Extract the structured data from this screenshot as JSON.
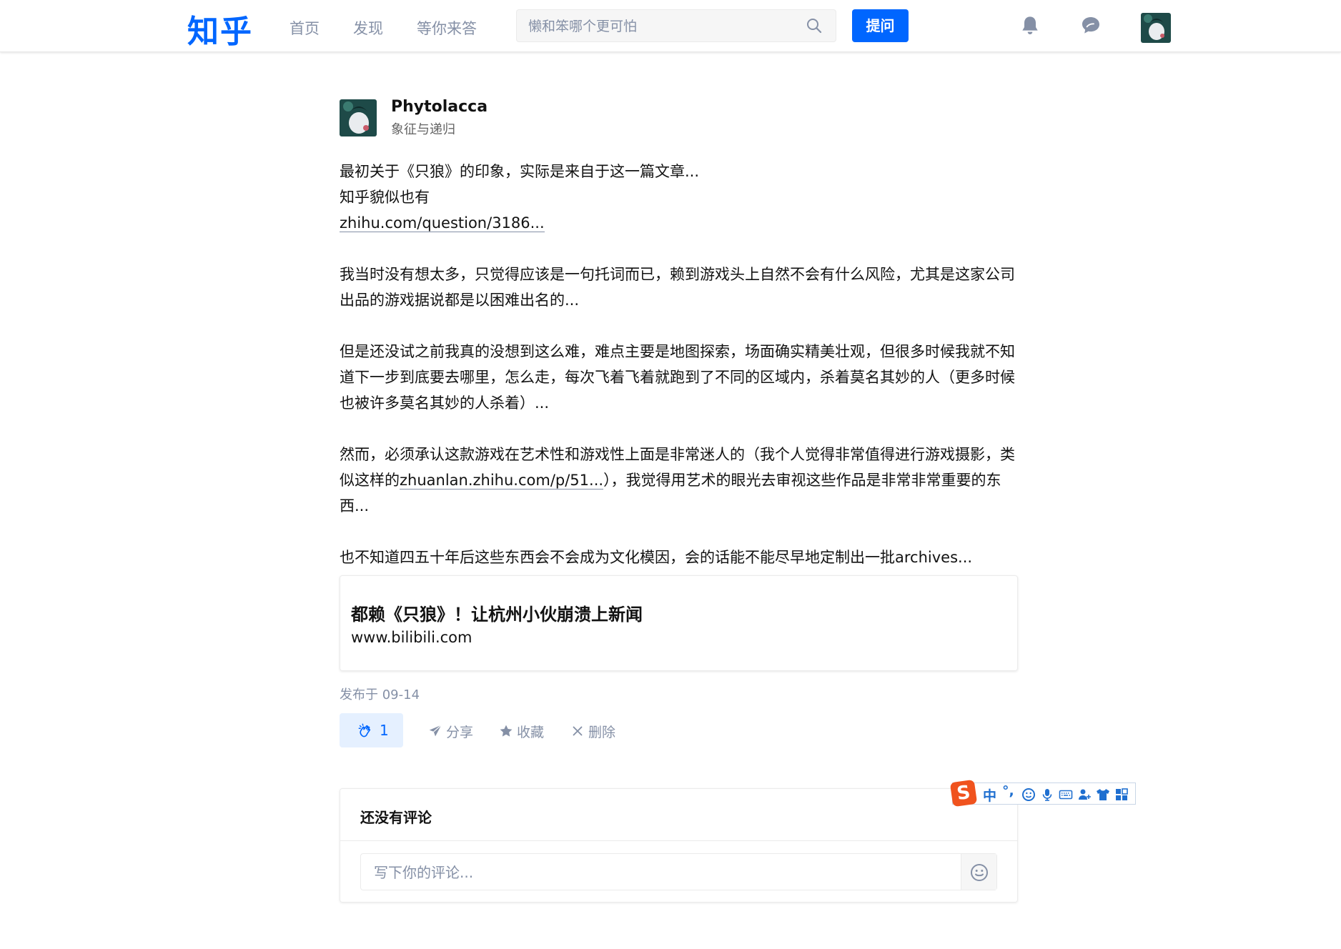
{
  "header": {
    "logo": "知乎",
    "nav": [
      "首页",
      "发现",
      "等你来答"
    ],
    "search_placeholder": "懒和笨哪个更可怕",
    "ask_label": "提问",
    "icons": [
      "bell-icon",
      "chat-icon"
    ],
    "accent_color": "#0066ff"
  },
  "post": {
    "author_name": "Phytolacca",
    "author_bio": "象征与递归",
    "paragraphs": {
      "p1_line1": "最初关于《只狼》的印象，实际是来自于这一篇文章...",
      "p1_line2": "知乎貌似也有",
      "p1_link": "zhihu.com/question/3186...",
      "p2": "我当时没有想太多，只觉得应该是一句托词而已，赖到游戏头上自然不会有什么风险，尤其是这家公司出品的游戏据说都是以困难出名的...",
      "p3": "但是还没试之前我真的没想到这么难，难点主要是地图探索，场面确实精美壮观，但很多时候我就不知道下一步到底要去哪里，怎么走，每次飞着飞着就跑到了不同的区域内，杀着莫名其妙的人（更多时候也被许多莫名其妙的人杀着）...",
      "p4_before": "然而，必须承认这款游戏在艺术性和游戏性上面是非常迷人的（我个人觉得非常值得进行游戏摄影，类似这样的",
      "p4_link": "zhuanlan.zhihu.com/p/51...",
      "p4_after": "），我觉得用艺术的眼光去审视这些作品是非常非常重要的东西...",
      "p5": "也不知道四五十年后这些东西会不会成为文化模因，会的话能不能尽早地定制出一批archives..."
    },
    "link_card": {
      "title": "都赖《只狼》！让杭州小伙崩溃上新闻",
      "url": "www.bilibili.com"
    },
    "publish_time": "发布于 09-14",
    "actions": {
      "like_count": "1",
      "share": "分享",
      "favorite": "收藏",
      "delete": "删除"
    }
  },
  "comments": {
    "empty_title": "还没有评论",
    "input_placeholder": "写下你的评论..."
  },
  "ime_toolbar": {
    "logo": "S",
    "mode": "中",
    "punct": "°,"
  }
}
